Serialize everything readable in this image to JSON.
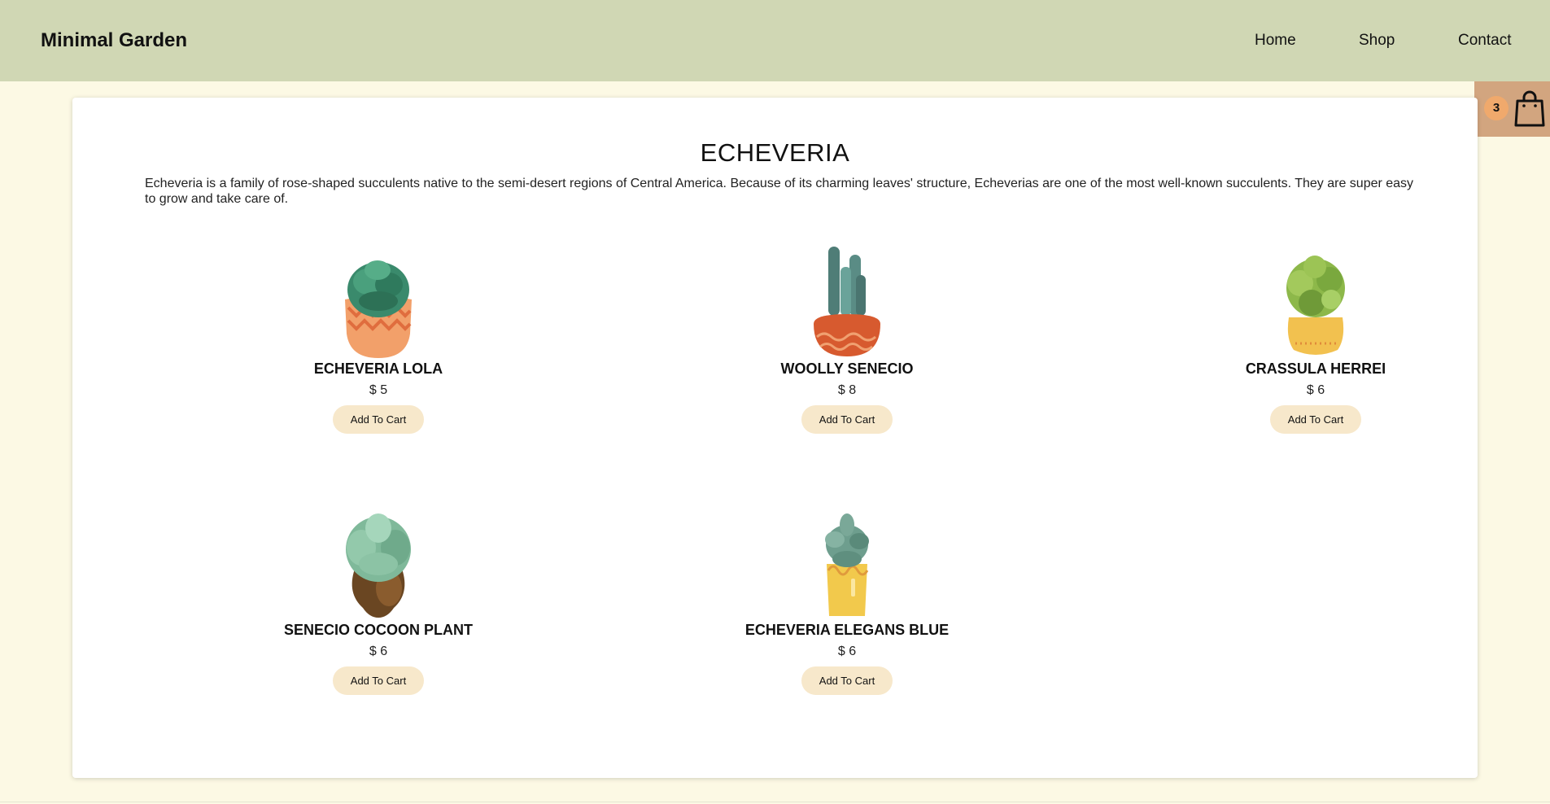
{
  "header": {
    "brand": "Minimal Garden",
    "nav": [
      "Home",
      "Shop",
      "Contact"
    ]
  },
  "cart": {
    "count": "3",
    "icon": "shopping-bag-icon"
  },
  "category": {
    "title": "ECHEVERIA",
    "description": "Echeveria is a family of rose-shaped succulents native to the semi-desert regions of Central America. Because of its charming leaves' structure, Echeverias are one of the most well-known succulents. They are super easy to grow and take care of."
  },
  "products": [
    {
      "name": "ECHEVERIA LOLA",
      "price": "$ 5",
      "button": "Add To Cart",
      "icon": "echeveria-lola-plant-icon"
    },
    {
      "name": "WOOLLY SENECIO",
      "price": "$ 8",
      "button": "Add To Cart",
      "icon": "woolly-senecio-plant-icon"
    },
    {
      "name": "CRASSULA HERREI",
      "price": "$ 6",
      "button": "Add To Cart",
      "icon": "crassula-herrei-plant-icon"
    },
    {
      "name": "SENECIO COCOON PLANT",
      "price": "$ 6",
      "button": "Add To Cart",
      "icon": "senecio-cocoon-plant-icon"
    },
    {
      "name": "ECHEVERIA ELEGANS BLUE",
      "price": "$ 6",
      "button": "Add To Cart",
      "icon": "echeveria-elegans-blue-plant-icon"
    }
  ],
  "colors": {
    "header_bg": "#d0d7b4",
    "page_bg": "#fcf9e4",
    "cart_bg": "#d2a57f",
    "badge_bg": "#f0a96c",
    "button_bg": "#f7e8cb"
  }
}
